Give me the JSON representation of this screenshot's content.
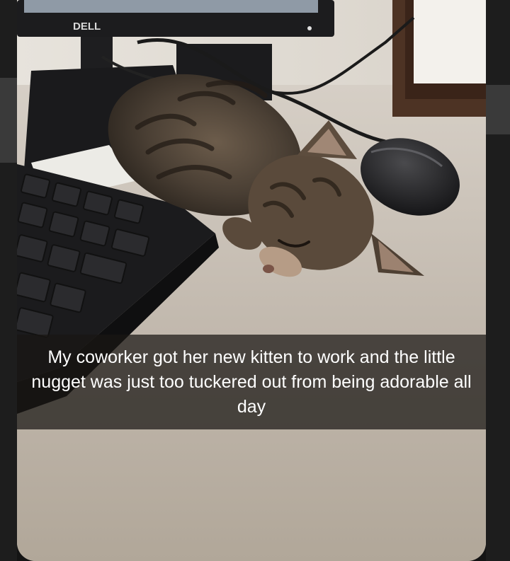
{
  "caption": {
    "text": "My coworker got her new kitten to work and the little nugget was just too tuckered out from being adorable all day"
  },
  "monitor": {
    "brand_logo": "DELL"
  },
  "colors": {
    "desk": "#bdb4aa",
    "caption_background": "#191614",
    "caption_text": "#ffffff",
    "page_background": "#141414"
  }
}
